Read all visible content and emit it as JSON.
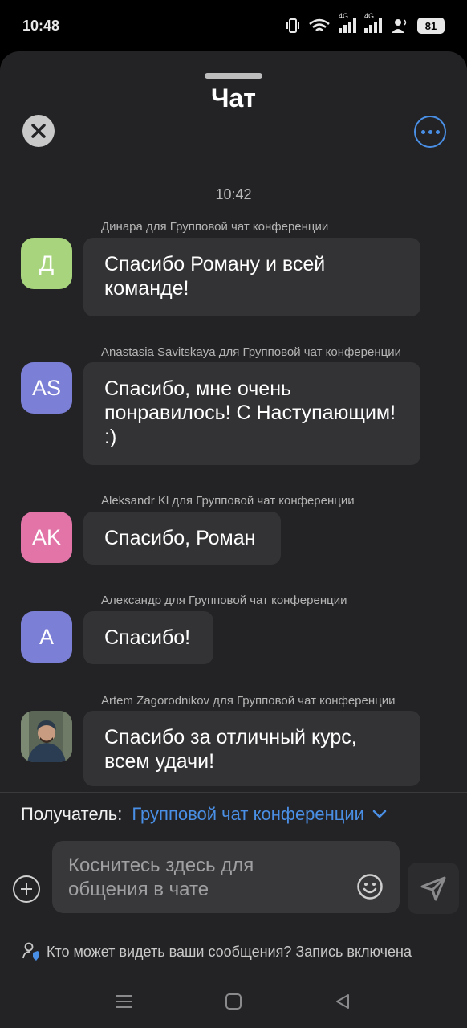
{
  "status_bar": {
    "time": "10:48",
    "network_1": "4G",
    "network_2": "4G",
    "battery": "81"
  },
  "header": {
    "title": "Чат"
  },
  "chat": {
    "timestamp": "10:42",
    "messages": [
      {
        "sender": "Динара для Групповой чат конференции",
        "avatar_initials": "Д",
        "avatar_color": "#a7d47c",
        "text": "Спасибо Роману и всей команде!"
      },
      {
        "sender": "Anastasia Savitskaya для Групповой чат конференции",
        "avatar_initials": "AS",
        "avatar_color": "#7b7fd6",
        "text": "Спасибо, мне очень понравилось! С Наступающим! :)"
      },
      {
        "sender": "Aleksandr Kl для Групповой чат конференции",
        "avatar_initials": "AK",
        "avatar_color": "#e274a8",
        "text": "Спасибо, Роман"
      },
      {
        "sender": "Александр для Групповой чат конференции",
        "avatar_initials": "A",
        "avatar_color": "#7b7fd6",
        "text": "Спасибо!"
      },
      {
        "sender": "Artem Zagorodnikov для Групповой чат конференции",
        "avatar_initials": "",
        "avatar_color": "#4d5a47",
        "text": "Спасибо за отличный курс, всем удачи!"
      }
    ]
  },
  "composer": {
    "recipient_label": "Получатель:",
    "recipient_value": "Групповой чат конференции",
    "placeholder": "Коснитесь здесь для общения в чате"
  },
  "footer": {
    "privacy_text": "Кто может видеть ваши сообщения? Запись включена"
  },
  "colors": {
    "accent": "#4a8fe6",
    "sheet_background": "#232325",
    "bubble_background": "#333335"
  }
}
